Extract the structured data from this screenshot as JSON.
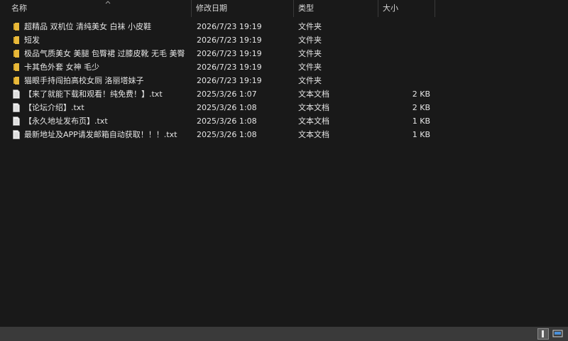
{
  "columns": {
    "name": "名称",
    "date": "修改日期",
    "type": "类型",
    "size": "大小"
  },
  "files": [
    {
      "kind": "folder",
      "name": "超精品 双机位 清纯美女 白袜 小皮鞋",
      "date": "2026/7/23 19:19",
      "type": "文件夹",
      "size": ""
    },
    {
      "kind": "folder",
      "name": "短发",
      "date": "2026/7/23 19:19",
      "type": "文件夹",
      "size": ""
    },
    {
      "kind": "folder",
      "name": "极品气质美女 美腿 包臀裙 过膝皮靴 无毛 美臀",
      "date": "2026/7/23 19:19",
      "type": "文件夹",
      "size": ""
    },
    {
      "kind": "folder",
      "name": "卡其色外套 女神 毛少",
      "date": "2026/7/23 19:19",
      "type": "文件夹",
      "size": ""
    },
    {
      "kind": "folder",
      "name": "猫眼手持闯拍高校女厕 洛丽塔妹子",
      "date": "2026/7/23 19:19",
      "type": "文件夹",
      "size": ""
    },
    {
      "kind": "text",
      "name": "【来了就能下载和观看！纯免费！】.txt",
      "date": "2025/3/26 1:07",
      "type": "文本文档",
      "size": "2 KB"
    },
    {
      "kind": "text",
      "name": "【论坛介绍】.txt",
      "date": "2025/3/26 1:08",
      "type": "文本文档",
      "size": "2 KB"
    },
    {
      "kind": "text",
      "name": "【永久地址发布页】.txt",
      "date": "2025/3/26 1:08",
      "type": "文本文档",
      "size": "1 KB"
    },
    {
      "kind": "text",
      "name": "最新地址及APP请发邮箱自动获取！！！.txt",
      "date": "2025/3/26 1:08",
      "type": "文本文档",
      "size": "1 KB"
    }
  ],
  "icons": {
    "folder": "folder-icon",
    "text": "text-file-icon",
    "sort": "sort-up-icon",
    "details_view": "details-view-icon",
    "tiles_view": "tiles-view-icon"
  },
  "colors": {
    "background": "#191919",
    "statusbar": "#3a3a3a",
    "folder": "#e8b93a",
    "text": "#e6e6e6"
  }
}
